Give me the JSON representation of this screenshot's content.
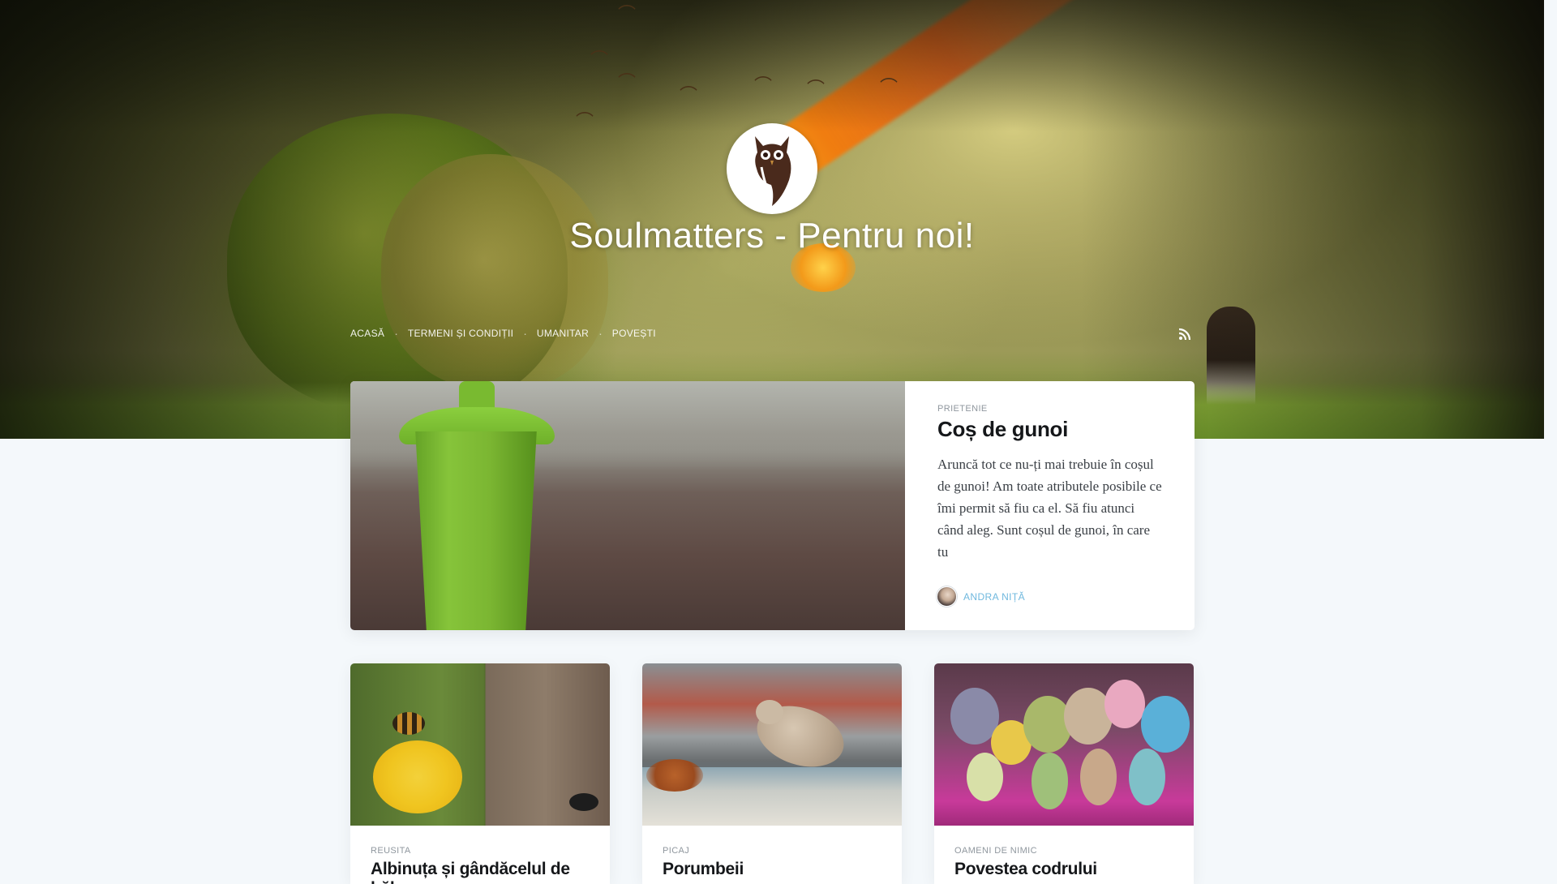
{
  "site": {
    "title": "Soulmatters - Pentru noi!"
  },
  "nav": {
    "items": [
      {
        "label": "ACASĂ"
      },
      {
        "label": "TERMENI ȘI CONDIȚII"
      },
      {
        "label": "UMANITAR"
      },
      {
        "label": "POVEȘTI"
      }
    ],
    "rss_icon": "rss-icon"
  },
  "featured": {
    "tag": "PRIETENIE",
    "title": "Coș de gunoi",
    "excerpt": "Aruncă tot ce nu-ți mai trebuie în coșul de gunoi! Am toate atributele posibile ce îmi permit să fiu ca el. Să fiu atunci când aleg. Sunt coșul de gunoi, în care tu",
    "author": "ANDRA NIȚĂ",
    "image_alt": "green trash bin"
  },
  "cards": [
    {
      "tag": "REUSITA",
      "title": "Albinuța și gândăcelul de bălegar",
      "image_alt": "bee on dandelion and dung beetle"
    },
    {
      "tag": "PICAJ",
      "title": "Porumbeii",
      "image_alt": "dove on basin"
    },
    {
      "tag": "OAMENI DE NIMIC",
      "title": "Povestea codrului",
      "image_alt": "crocheted toys"
    }
  ],
  "colors": {
    "accent": "#6fb8de",
    "page_bg": "#f4f8fb",
    "text_dark": "#15171a",
    "tag_gray": "#8f979e"
  }
}
